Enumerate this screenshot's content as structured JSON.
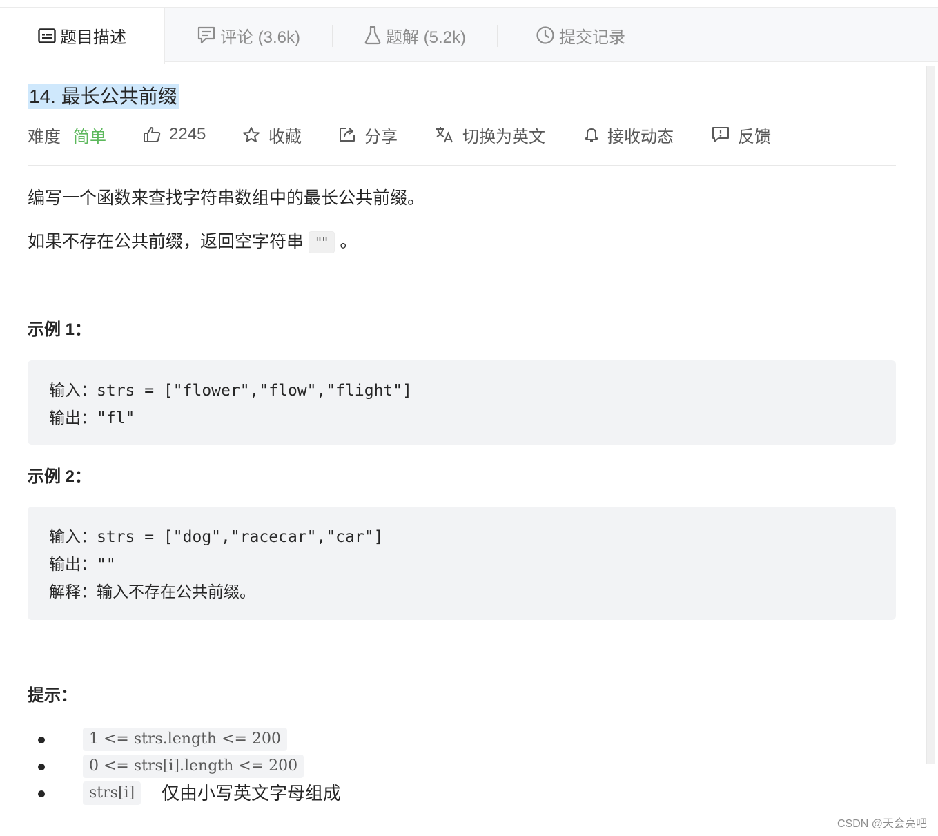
{
  "tabs": [
    {
      "label": "题目描述",
      "icon": "description-icon"
    },
    {
      "label": "评论 (3.6k)",
      "icon": "comment-icon"
    },
    {
      "label": "题解 (5.2k)",
      "icon": "flask-icon"
    },
    {
      "label": "提交记录",
      "icon": "clock-icon"
    }
  ],
  "problem": {
    "title": "14. 最长公共前缀",
    "difficulty_label": "难度",
    "difficulty": "简单",
    "likes": "2245",
    "favorite": "收藏",
    "share": "分享",
    "translate": "切换为英文",
    "subscribe": "接收动态",
    "feedback": "反馈"
  },
  "description": {
    "line1": "编写一个函数来查找字符串数组中的最长公共前缀。",
    "line2_prefix": "如果不存在公共前缀，返回空字符串",
    "line2_code": "\"\"",
    "line2_suffix": "。"
  },
  "examples": [
    {
      "heading": "示例 1：",
      "input_label": "输入：",
      "input": "strs = [\"flower\",\"flow\",\"flight\"]",
      "output_label": "输出：",
      "output": "\"fl\""
    },
    {
      "heading": "示例 2：",
      "input_label": "输入：",
      "input": "strs = [\"dog\",\"racecar\",\"car\"]",
      "output_label": "输出：",
      "output": "\"\"",
      "explain_label": "解释：",
      "explain": "输入不存在公共前缀。"
    }
  ],
  "hints": {
    "heading": "提示：",
    "items": [
      {
        "code": "1 <= strs.length <= 200",
        "text": ""
      },
      {
        "code": "0 <= strs[i].length <= 200",
        "text": ""
      },
      {
        "code": "strs[i]",
        "text": "仅由小写英文字母组成"
      }
    ]
  },
  "watermark": "CSDN @天会亮吧",
  "colors": {
    "easy": "#5cb85c",
    "title_highlight": "#cfe8fc",
    "code_bg": "#f2f3f5"
  }
}
